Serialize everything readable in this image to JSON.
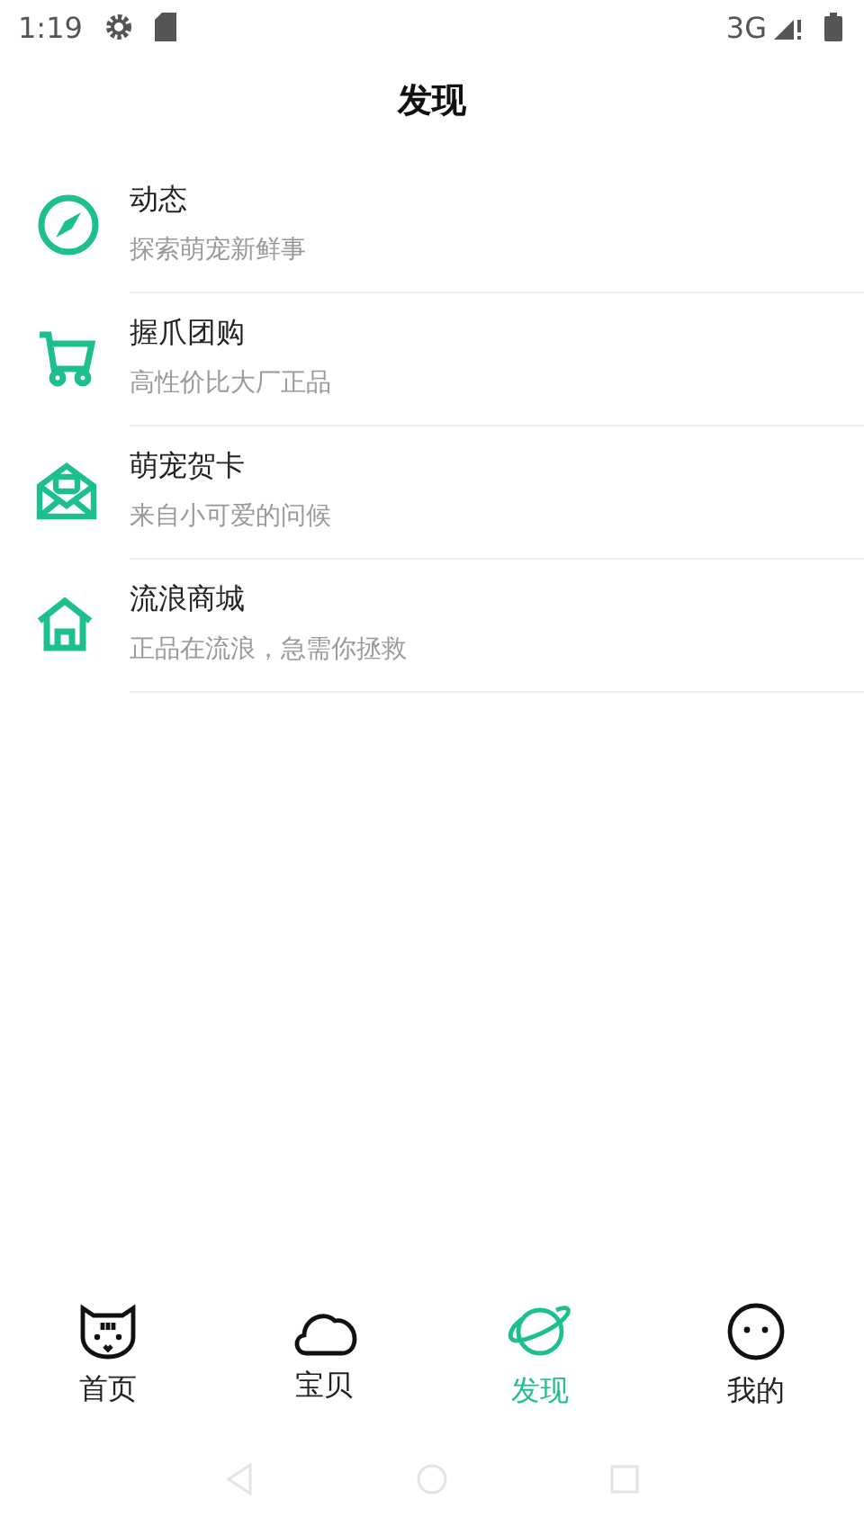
{
  "status_bar": {
    "time": "1:19",
    "network": "3G"
  },
  "title": "发现",
  "items": [
    {
      "kind": "compass",
      "title": "动态",
      "subtitle": "探索萌宠新鲜事"
    },
    {
      "kind": "cart",
      "title": "握爪团购",
      "subtitle": "高性价比大厂正品"
    },
    {
      "kind": "mail",
      "title": "萌宠贺卡",
      "subtitle": "来自小可爱的问候"
    },
    {
      "kind": "house",
      "title": "流浪商城",
      "subtitle": "正品在流浪，急需你拯救"
    }
  ],
  "tabs": [
    {
      "kind": "cat",
      "label": "首页",
      "selected": false
    },
    {
      "kind": "cloud",
      "label": "宝贝",
      "selected": false
    },
    {
      "kind": "planet",
      "label": "发现",
      "selected": true
    },
    {
      "kind": "face",
      "label": "我的",
      "selected": false
    }
  ]
}
